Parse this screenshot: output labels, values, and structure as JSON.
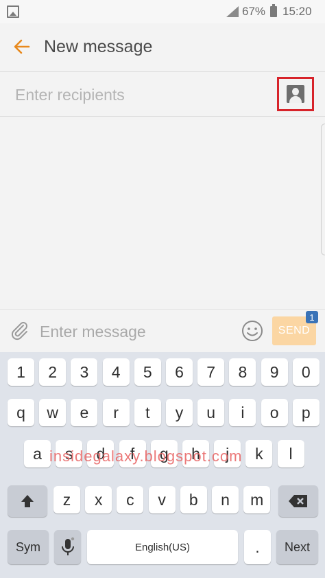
{
  "status_bar": {
    "battery_percent": "67%",
    "time": "15:20"
  },
  "app_bar": {
    "title": "New message"
  },
  "recipients": {
    "placeholder": "Enter recipients"
  },
  "composer": {
    "placeholder": "Enter message",
    "send_label": "SEND",
    "sim_badge": "1"
  },
  "keyboard": {
    "row_numbers": [
      "1",
      "2",
      "3",
      "4",
      "5",
      "6",
      "7",
      "8",
      "9",
      "0"
    ],
    "row_1": [
      "q",
      "w",
      "e",
      "r",
      "t",
      "y",
      "u",
      "i",
      "o",
      "p"
    ],
    "row_2": [
      "a",
      "s",
      "d",
      "f",
      "g",
      "h",
      "j",
      "k",
      "l"
    ],
    "row_3": [
      "z",
      "x",
      "c",
      "v",
      "b",
      "n",
      "m"
    ],
    "sym_label": "Sym",
    "space_label": "English(US)",
    "period_label": ".",
    "next_label": "Next"
  },
  "watermark": "insidegalaxy.blogspot.com",
  "colors": {
    "accent": "#e8891d",
    "highlight_box": "#d7232a",
    "send_bg": "#fbd6a3",
    "badge": "#3a73b7"
  }
}
